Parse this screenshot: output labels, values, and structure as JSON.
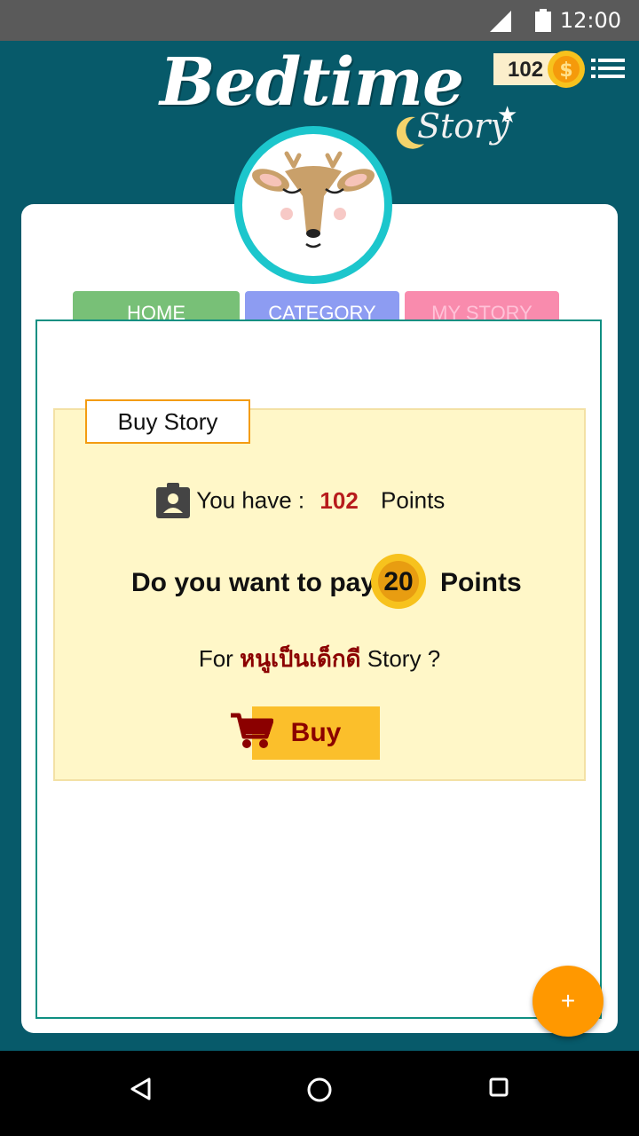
{
  "status": {
    "time": "12:00",
    "icons": [
      "signal-icon",
      "battery-icon"
    ]
  },
  "header": {
    "logo_main": "Bedtime",
    "logo_sub": "Story",
    "coins": "102",
    "coin_icon": "dollar-coin-icon",
    "menu_icon": "menu-list-icon"
  },
  "tabs": [
    {
      "label": "HOME",
      "color": "#78c077"
    },
    {
      "label": "CATEGORY",
      "color": "#8d9cf2"
    },
    {
      "label": "MY STORY",
      "color": "#f98bad"
    }
  ],
  "dialog": {
    "legend": "Buy Story",
    "have_label": "You have :",
    "have_points": "102",
    "points_word": "Points",
    "pay_prefix": "Do you want to pay",
    "pay_amount": "20",
    "pay_suffix": "Points",
    "for_label": "For",
    "story_name": "หนูเป็นเด็กดี",
    "story_suffix": "Story ?",
    "buy_label": "Buy"
  },
  "fab": {
    "label": "+"
  },
  "colors": {
    "background": "#075a6a",
    "accent": "#ff9800",
    "highlight": "#b71c1c"
  }
}
